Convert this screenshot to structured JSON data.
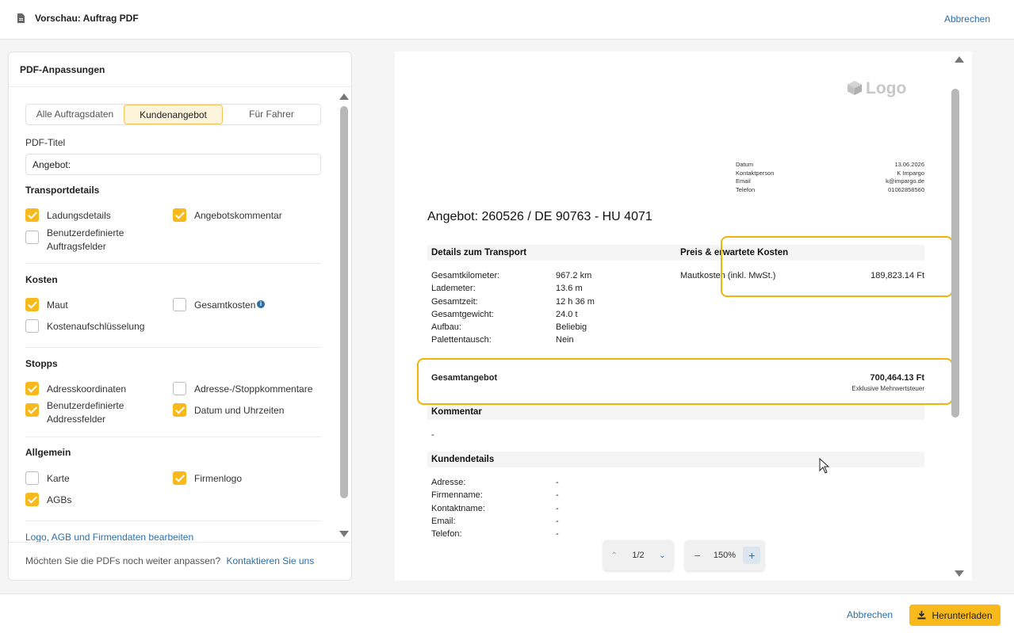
{
  "window": {
    "title": "Vorschau: Auftrag PDF",
    "cancel": "Abbrechen"
  },
  "sidebar": {
    "title": "PDF-Anpassungen",
    "tabs": [
      {
        "label": "Alle Auftragsdaten",
        "active": false
      },
      {
        "label": "Kundenangebot",
        "active": true
      },
      {
        "label": "Für Fahrer",
        "active": false
      }
    ],
    "pdf_title_label": "PDF-Titel",
    "pdf_title_value": "Angebot:",
    "sections": {
      "transport": {
        "title": "Transportdetails",
        "items": [
          {
            "label": "Ladungsdetails",
            "checked": true
          },
          {
            "label": "Angebotskommentar",
            "checked": true
          },
          {
            "label": "Benutzerdefinierte Auftragsfelder",
            "checked": false
          }
        ]
      },
      "kosten": {
        "title": "Kosten",
        "items": [
          {
            "label": "Maut",
            "checked": true
          },
          {
            "label": "Gesamtkosten",
            "checked": false
          },
          {
            "label": "Kostenaufschlüsselung",
            "checked": false
          }
        ]
      },
      "stopps": {
        "title": "Stopps",
        "items": [
          {
            "label": "Adresskoordinaten",
            "checked": true
          },
          {
            "label": "Adresse-/Stoppkommentare",
            "checked": false
          },
          {
            "label": "Benutzerdefinierte Addressfelder",
            "checked": true
          },
          {
            "label": "Datum und Uhrzeiten",
            "checked": true
          }
        ]
      },
      "allgemein": {
        "title": "Allgemein",
        "items": [
          {
            "label": "Karte",
            "checked": false
          },
          {
            "label": "Firmenlogo",
            "checked": true
          },
          {
            "label": "AGBs",
            "checked": true
          }
        ]
      }
    },
    "edit_link": "Logo, AGB und Firmendaten bearbeiten",
    "footer_text": "Möchten Sie die PDFs noch weiter anpassen?",
    "footer_link": "Kontaktieren Sie uns"
  },
  "preview": {
    "logo": "Logo",
    "meta": [
      {
        "key": "Datum",
        "value": "13.06.2026"
      },
      {
        "key": "Kontaktperson",
        "value": "K Impargo"
      },
      {
        "key": "Email",
        "value": "k@impargo.de"
      },
      {
        "key": "Telefon",
        "value": "01062858560"
      }
    ],
    "doc_title": "Angebot: 260526 / DE 90763 - HU 4071",
    "transport_header": "Details zum Transport",
    "costs_header": "Preis & erwartete Kosten",
    "transport_rows": [
      {
        "key": "Gesamtkilometer:",
        "value": "967.2 km"
      },
      {
        "key": "Lademeter:",
        "value": "13.6 m"
      },
      {
        "key": "Gesamtzeit:",
        "value": "12 h 36 m"
      },
      {
        "key": "Gesamtgewicht:",
        "value": "24.0 t"
      },
      {
        "key": "Aufbau:",
        "value": "Beliebig"
      },
      {
        "key": "Palettentausch:",
        "value": "Nein"
      }
    ],
    "toll_label": "Mautkosten (inkl. MwSt.)",
    "toll_value": "189,823.14 Ft",
    "total_label": "Gesamtangebot",
    "total_value": "700,464.13 Ft",
    "total_note": "Exklusive Mehrwertsteuer",
    "comment_header": "Kommentar",
    "comment_value": "-",
    "customer_header": "Kundendetails",
    "customer_rows": [
      {
        "key": "Adresse:",
        "value": "-"
      },
      {
        "key": "Firmenname:",
        "value": "-"
      },
      {
        "key": "Kontaktname:",
        "value": "-"
      },
      {
        "key": "Email:",
        "value": "-"
      },
      {
        "key": "Telefon:",
        "value": "-"
      }
    ],
    "page_indicator": "1/2",
    "zoom_level": "150%"
  },
  "footer": {
    "cancel": "Abbrechen",
    "download": "Herunterladen"
  },
  "colors": {
    "accent": "#f7b91b",
    "link": "#2f6fa8",
    "highlight": "#f2b308"
  }
}
